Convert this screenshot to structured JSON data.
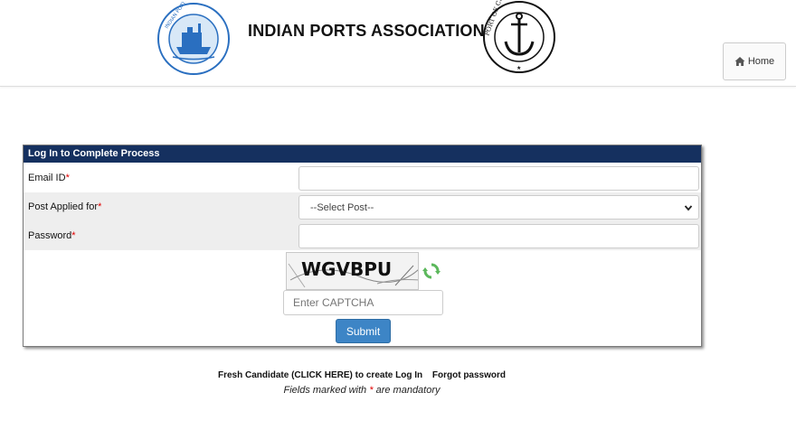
{
  "header": {
    "org_title": "INDIAN PORTS ASSOCIATION",
    "left_logo_text": "INDIAN PORTS ASSOCIATION",
    "right_logo_text": "PORT OF CHENNAI",
    "home_label": "Home"
  },
  "form": {
    "title": "Log In to Complete Process",
    "email_label": "Email ID",
    "email_value": "",
    "post_label": "Post Applied for",
    "post_selected": "--Select Post--",
    "password_label": "Password",
    "password_value": "",
    "required_mark": "*",
    "captcha_code": "WGVBPU",
    "captcha_placeholder": "Enter CAPTCHA",
    "submit_label": "Submit"
  },
  "footer": {
    "fresh_candidate_link": "Fresh Candidate (CLICK HERE) to create Log In",
    "forgot_password_link": "Forgot password",
    "mandatory_note_prefix": "Fields marked with ",
    "mandatory_note_mark": "*",
    "mandatory_note_suffix": " are mandatory"
  },
  "colors": {
    "panel_header": "#15305f",
    "submit_button": "#3d85c6",
    "required": "#e00000",
    "refresh_icon": "#5cb85c"
  },
  "icons": [
    "home-icon",
    "refresh-icon",
    "chevron-down-icon"
  ]
}
